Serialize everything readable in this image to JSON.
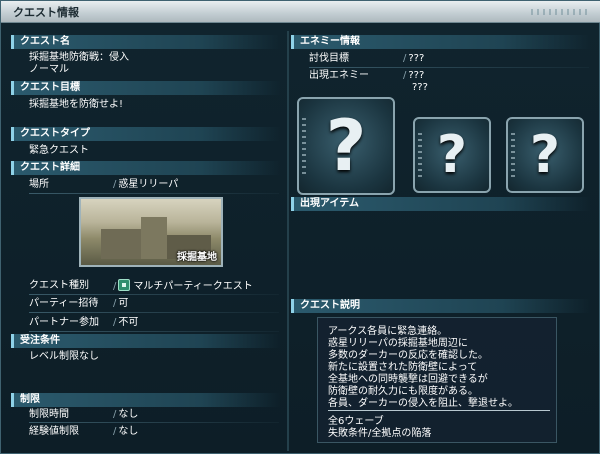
{
  "window": {
    "title": "クエスト情報"
  },
  "left": {
    "quest_name": {
      "header": "クエスト名",
      "lines": [
        "採掘基地防衛戦：侵入",
        "ノーマル"
      ]
    },
    "quest_goal": {
      "header": "クエスト目標",
      "text": "採掘基地を防衛せよ!"
    },
    "quest_type": {
      "header": "クエストタイプ",
      "text": "緊急クエスト"
    },
    "quest_detail": {
      "header": "クエスト詳細",
      "location_label": "場所",
      "location_value": "惑星リリーパ",
      "thumbnail_caption": "採掘基地",
      "kind_label": "クエスト種別",
      "kind_value": "マルチパーティークエスト",
      "party_invite_label": "パーティー招待",
      "party_invite_value": "可",
      "partner_label": "パートナー参加",
      "partner_value": "不可"
    },
    "conditions": {
      "header": "受注条件",
      "text": "レベル制限なし"
    },
    "limits": {
      "header": "制限",
      "time_label": "制限時間",
      "time_value": "なし",
      "exp_label": "経験値制限",
      "exp_value": "なし"
    }
  },
  "right": {
    "enemy": {
      "header": "エネミー情報",
      "target_label": "討伐目標",
      "target_value": "???",
      "appear_label": "出現エネミー",
      "appear_values": [
        "???",
        "???"
      ],
      "unknown_icons": [
        "?",
        "?",
        "?"
      ]
    },
    "items": {
      "header": "出現アイテム"
    },
    "description": {
      "header": "クエスト説明",
      "lines": [
        "アークス各員に緊急連絡。",
        "惑星リリーパの採掘基地周辺に",
        "多数のダーカーの反応を確認した。",
        "新たに設置された防衛壁によって",
        "全基地への同時襲撃は回避できるが",
        "防衛壁の耐久力にも限度がある。",
        "各員、ダーカーの侵入を阻止、撃退せよ。"
      ],
      "footer_lines": [
        "全6ウェーブ",
        "失敗条件/全拠点の陥落"
      ]
    }
  },
  "colors": {
    "header_accent": "#8fd2e8",
    "panel_bg": "#10242e",
    "titlebar": "#c2cdd2"
  }
}
